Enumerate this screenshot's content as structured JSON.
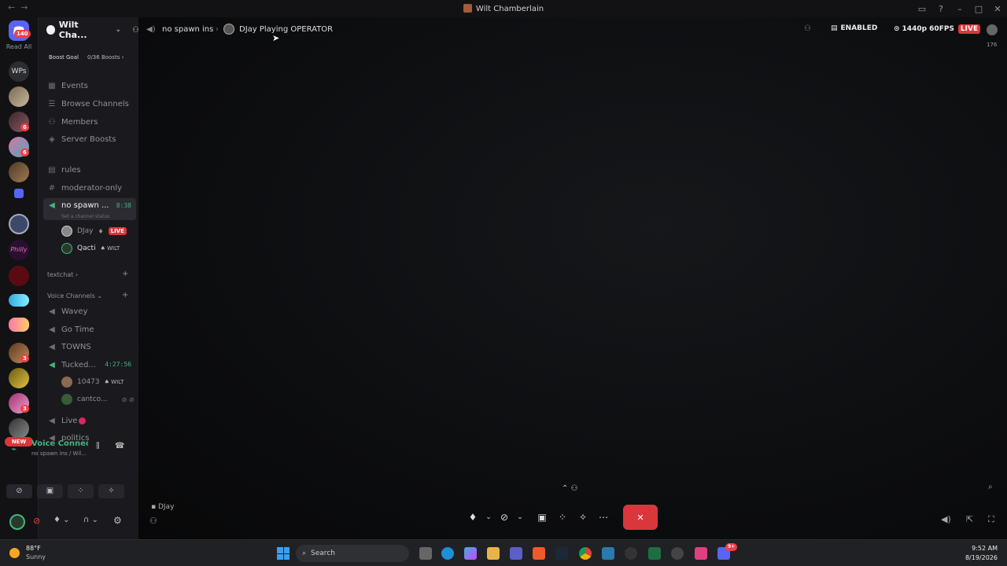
{
  "window": {
    "title": "Wilt Chamberlain"
  },
  "guilds": {
    "dm_badge": "140",
    "read_all": "Read All",
    "wps_label": "WPs",
    "badges": [
      "6",
      "6",
      "3",
      "3"
    ],
    "new_label": "NEW"
  },
  "server": {
    "name": "Wilt Cha...",
    "boost_goal_label": "Boost Goal",
    "boost_count": "0/36 Boosts",
    "nav": [
      "Events",
      "Browse Channels",
      "Members",
      "Server Boosts"
    ],
    "channels": {
      "rules": "rules",
      "moderator": "moderator-only",
      "voice_active": "no spawn ...",
      "voice_active_time": "8:38",
      "voice_status": "Set a channel status",
      "user1": "DJay",
      "user1_live": "LIVE",
      "user2": "Qacti",
      "user2_tag": "WILT",
      "textchat": "textchat",
      "voice_category": "Voice Channels",
      "wavey": "Wavey",
      "gotime": "Go Time",
      "towns": "TOWNS",
      "tucked": "Tucked...",
      "tucked_time": "4:27:56",
      "user3": "10473",
      "user3_tag": "WILT",
      "user4": "cantco...",
      "live_ch": "Live",
      "politics": "politics"
    }
  },
  "voice_panel": {
    "status": "Voice Connecte",
    "location": "no spawn ins / Wil..."
  },
  "topbar": {
    "channel": "no spawn ins",
    "activity": "DJay Playing OPERATOR",
    "enabled": "ENABLED",
    "quality": "1440p 60FPS",
    "live": "LIVE",
    "viewers": "176"
  },
  "stage": {
    "streamer": "DJay"
  },
  "taskbar": {
    "temp": "88°F",
    "weather": "Sunny",
    "search": "Search",
    "time": "9:52 AM",
    "date": "8/19/2026",
    "notif_badge": "9+"
  }
}
